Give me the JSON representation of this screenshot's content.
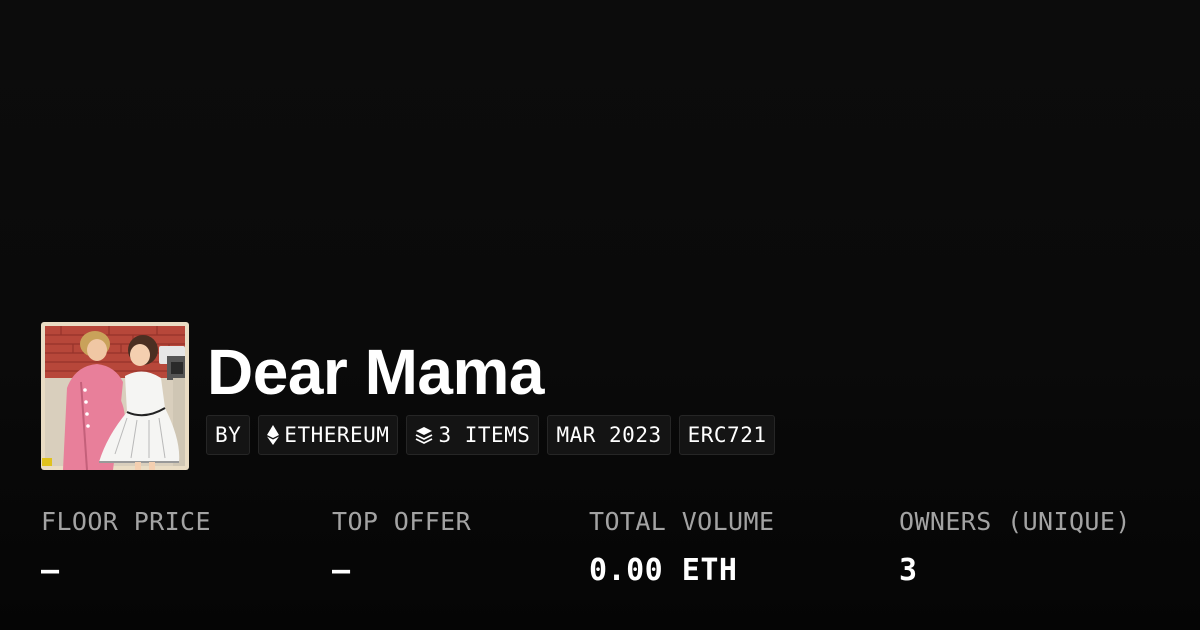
{
  "collection": {
    "title": "Dear Mama",
    "image_alt": "Vintage illustration of a mother adjusting her daughter's white dress"
  },
  "tags": {
    "by": "BY",
    "chain": {
      "label": "ETHEREUM",
      "icon": "ethereum-icon"
    },
    "items": {
      "label": "3 ITEMS",
      "icon": "layers-icon"
    },
    "date": "MAR 2023",
    "standard": "ERC721"
  },
  "stats": [
    {
      "label": "FLOOR PRICE",
      "value": "–"
    },
    {
      "label": "TOP OFFER",
      "value": "–"
    },
    {
      "label": "TOTAL VOLUME",
      "value": "0.00 ETH"
    },
    {
      "label": "OWNERS (UNIQUE)",
      "value": "3"
    }
  ],
  "colors": {
    "background": "#0a0a0a",
    "text": "#ffffff",
    "muted": "#a3a3a3",
    "tag_background": "#141414",
    "tag_border": "#262626"
  }
}
